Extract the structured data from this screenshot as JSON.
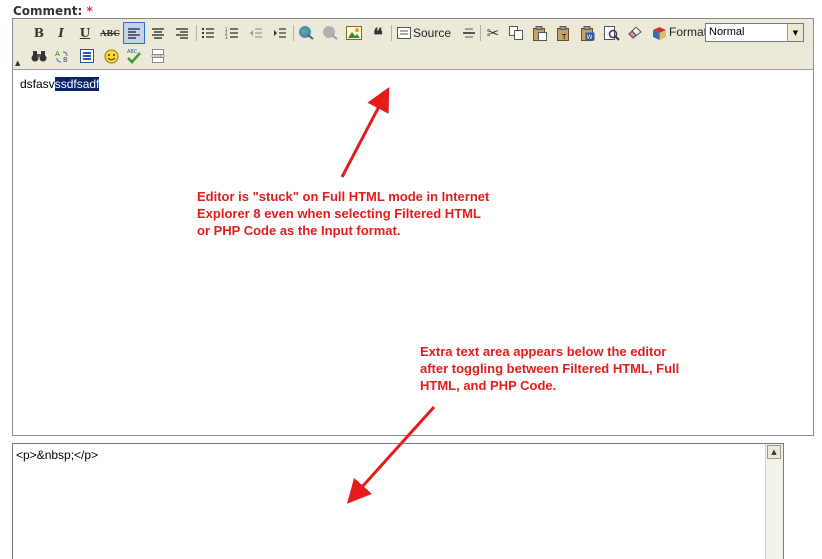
{
  "field": {
    "label": "Comment:",
    "required_mark": "*"
  },
  "toolbar": {
    "bold": "B",
    "italic": "I",
    "underline": "U",
    "strike": "ABC",
    "source_label": "Source",
    "format_label": "Format",
    "format_value": "Normal"
  },
  "editor": {
    "text_plain": "dsfasv",
    "text_selected": "ssdfsadf"
  },
  "annotations": {
    "note1": "Editor is \"stuck\" on Full HTML mode in Internet\nExplorer 8 even when selecting Filtered HTML\nor PHP Code as the Input format.",
    "note2": "Extra text area appears below the editor\nafter toggling between Filtered HTML, Full\nHTML, and PHP Code."
  },
  "textarea": {
    "value": "<p>&nbsp;</p>"
  },
  "colors": {
    "annotation": "#e41c1c",
    "selection": "#0a246a",
    "toolbar_bg": "#ece9d8"
  }
}
